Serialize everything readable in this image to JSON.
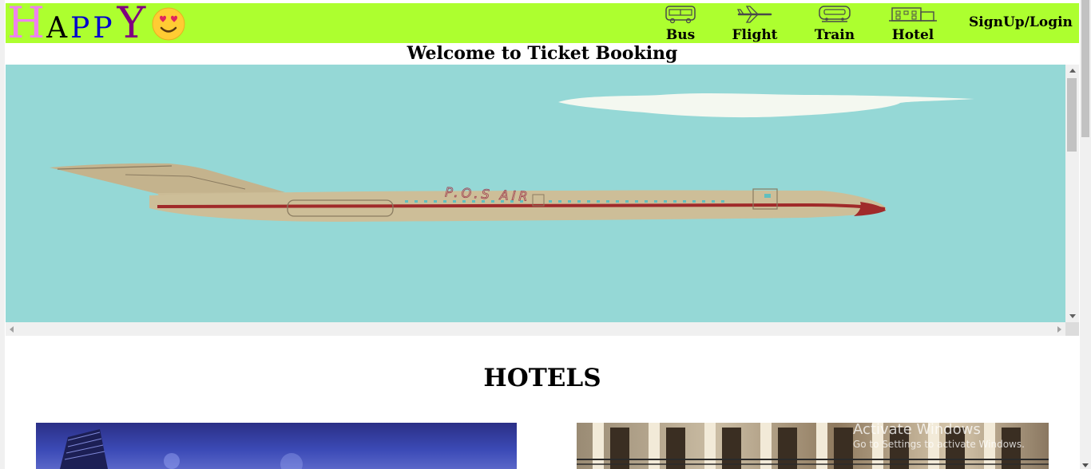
{
  "header": {
    "logo": {
      "letters": [
        "H",
        "A",
        "P",
        "P",
        "Y"
      ],
      "emoji": "heart-eyes-emoji"
    },
    "nav": [
      {
        "label": "Bus",
        "icon": "bus-icon"
      },
      {
        "label": "Flight",
        "icon": "airplane-icon"
      },
      {
        "label": "Train",
        "icon": "train-icon"
      },
      {
        "label": "Hotel",
        "icon": "building-icon"
      }
    ],
    "signup_label": "SignUp/Login",
    "background": "#adff2f"
  },
  "welcome": "Welcome to Ticket Booking",
  "banner": {
    "plane_text": "P.O.S  AIR",
    "sky_color": "#95d8d6"
  },
  "hotels": {
    "title": "HOTELS"
  },
  "watermark": {
    "title": "Activate Windows",
    "subtitle": "Go to Settings to activate Windows."
  }
}
